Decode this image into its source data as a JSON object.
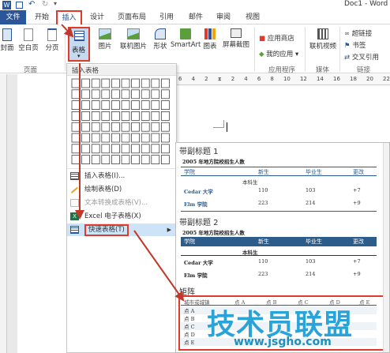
{
  "window": {
    "title": "Doc1 - Word"
  },
  "tabs": [
    {
      "label": "文件"
    },
    {
      "label": "开始"
    },
    {
      "label": "插入"
    },
    {
      "label": "设计"
    },
    {
      "label": "页面布局"
    },
    {
      "label": "引用"
    },
    {
      "label": "邮件"
    },
    {
      "label": "审阅"
    },
    {
      "label": "视图"
    }
  ],
  "ribbon": {
    "cover": "封面",
    "blank": "空白页",
    "pagebreak": "分页",
    "table": "表格",
    "picture": "图片",
    "onlinepic": "联机图片",
    "shapes": "形状",
    "smartart": "SmartArt",
    "chart": "图表",
    "screenshot": "屏幕截图",
    "store": "应用商店",
    "myapps": "我的应用",
    "onlinevideo": "联机视频",
    "hyperlink": "超链接",
    "bookmark": "书签",
    "crossref": "交叉引用",
    "group_pages": "页面",
    "group_apps": "应用程序",
    "group_media": "媒体",
    "group_links": "链接"
  },
  "menu": {
    "header": "插入表格",
    "items": [
      {
        "label": "插入表格(I)..."
      },
      {
        "label": "绘制表格(D)"
      },
      {
        "label": "文本转换成表格(V)..."
      },
      {
        "label": "Excel 电子表格(X)"
      },
      {
        "label": "快速表格(T)"
      }
    ]
  },
  "ruler": {
    "marks": [
      "6",
      "4",
      "2",
      "2",
      "4",
      "6",
      "8",
      "10",
      "12",
      "14",
      "16",
      "18",
      "20",
      "22"
    ]
  },
  "gallery": {
    "t1": {
      "title": "带副标题 1",
      "caption": "2005 年地方院校招生人数",
      "headers": [
        "学院",
        "新生",
        "毕业生",
        "更改"
      ],
      "subhead": "本科生",
      "rows": [
        [
          "Cedar 大学",
          "110",
          "103",
          "+7"
        ],
        [
          "Elm 学院",
          "223",
          "214",
          "+9"
        ]
      ]
    },
    "t2": {
      "title": "带副标题 2",
      "caption": "2005 年地方院校招生人数",
      "headers": [
        "学院",
        "新生",
        "毕业生",
        "更改"
      ],
      "subhead": "本科生",
      "rows": [
        [
          "Cedar 大学",
          "110",
          "103",
          "+7"
        ],
        [
          "Elm 学院",
          "223",
          "214",
          "+9"
        ]
      ]
    },
    "t3": {
      "title": "矩阵",
      "headers": [
        "城市或城镇",
        "点 A",
        "点 B",
        "点 C",
        "点 D",
        "点 E"
      ],
      "rows": [
        "点 A",
        "点 B",
        "点 C",
        "点 D",
        "点 E"
      ]
    }
  },
  "watermark": {
    "line1": "技术员联盟",
    "line2": "www.jsgho.com"
  }
}
